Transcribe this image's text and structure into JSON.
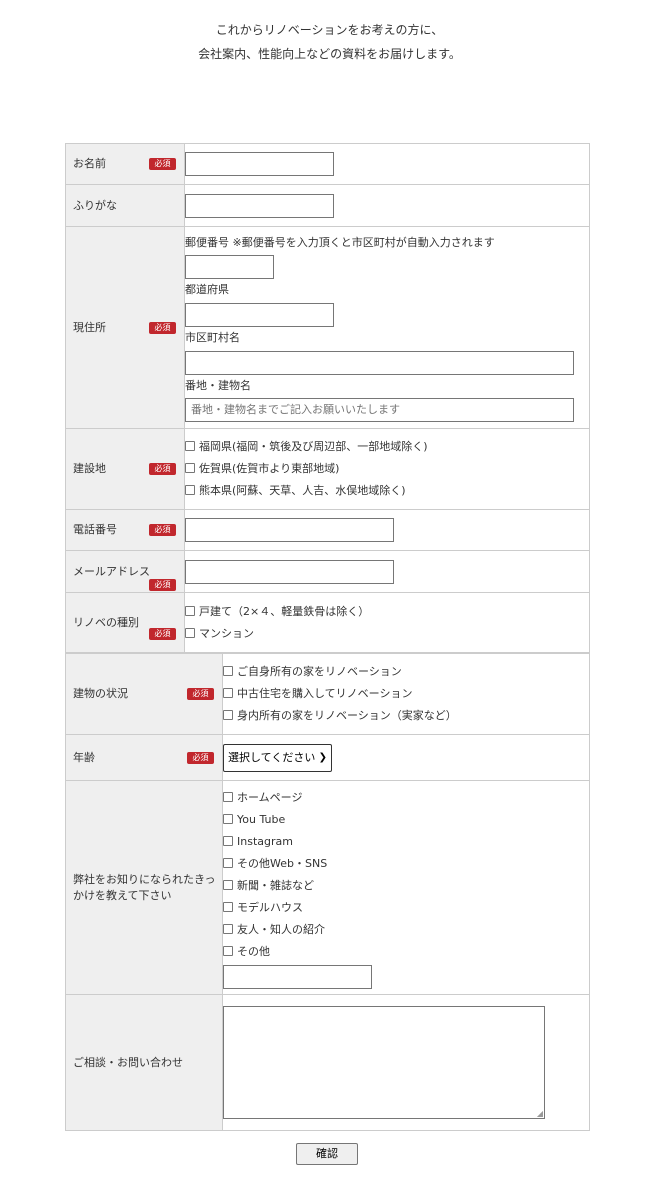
{
  "intro": {
    "line1": "これからリノベーションをお考えの方に、",
    "line2": "会社案内、性能向上などの資料をお届けします。"
  },
  "required_badge": "必須",
  "fields": {
    "name": {
      "label": "お名前",
      "value": ""
    },
    "furigana": {
      "label": "ふりがな",
      "value": ""
    },
    "address": {
      "label": "現住所",
      "postal_label": "郵便番号 ※郵便番号を入力頂くと市区町村が自動入力されます",
      "postal_value": "",
      "prefecture_label": "都道府県",
      "prefecture_value": "",
      "city_label": "市区町村名",
      "city_value": "",
      "street_label": "番地・建物名",
      "street_placeholder": "番地・建物名までご記入お願いいたします"
    },
    "build_site": {
      "label": "建設地",
      "options": [
        "福岡県(福岡・筑後及び周辺部、一部地域除く)",
        "佐賀県(佐賀市より東部地域)",
        "熊本県(阿蘇、天草、人吉、水俣地域除く)"
      ]
    },
    "phone": {
      "label": "電話番号",
      "value": ""
    },
    "email": {
      "label": "メールアドレス",
      "value": ""
    },
    "renovation_type": {
      "label": "リノベの種別",
      "options": [
        "戸建て（2×４、軽量鉄骨は除く）",
        "マンション"
      ]
    },
    "building_status": {
      "label": "建物の状況",
      "options": [
        "ご自身所有の家をリノベーション",
        "中古住宅を購入してリノベーション",
        "身内所有の家をリノベーション（実家など）"
      ]
    },
    "age": {
      "label": "年齢",
      "selected": "選択してください"
    },
    "source": {
      "label_line1": "弊社をお知りになられたきっ",
      "label_line2": "かけを教えて下さい",
      "options": [
        "ホームページ",
        "You Tube",
        "Instagram",
        "その他Web・SNS",
        "新聞・雑誌など",
        "モデルハウス",
        "友人・知人の紹介",
        "その他"
      ],
      "other_value": ""
    },
    "inquiry": {
      "label": "ご相談・お問い合わせ",
      "value": ""
    }
  },
  "submit_label": "確認"
}
